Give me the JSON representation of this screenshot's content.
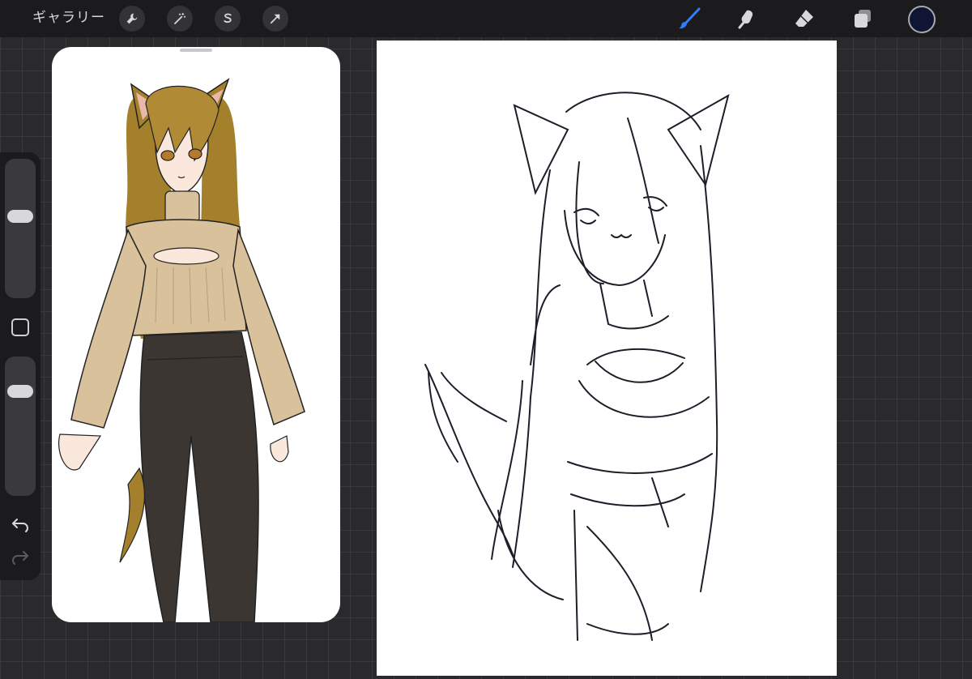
{
  "topbar": {
    "gallery_label": "ギャラリー",
    "left_tools": [
      {
        "name": "wrench-icon",
        "label": "actions"
      },
      {
        "name": "magic-wand-icon",
        "label": "adjustments"
      },
      {
        "name": "selection-s-icon",
        "label": "selection"
      },
      {
        "name": "transform-arrow-icon",
        "label": "transform"
      }
    ],
    "right_tools": [
      {
        "name": "brush-icon",
        "active": true
      },
      {
        "name": "smudge-icon"
      },
      {
        "name": "eraser-icon"
      },
      {
        "name": "layers-icon"
      }
    ],
    "current_color": "#0f1533"
  },
  "sidebar": {
    "brush_size_level": 0.38,
    "opacity_level": 0.25,
    "icons": [
      "modify-square-icon",
      "undo-icon",
      "redo-icon"
    ]
  },
  "colors": {
    "active_tool": "#2f7dff",
    "toolbar_bg": "#1b1b1d",
    "canvas_bg": "#ffffff",
    "grid_line": "#3a3a3d"
  }
}
